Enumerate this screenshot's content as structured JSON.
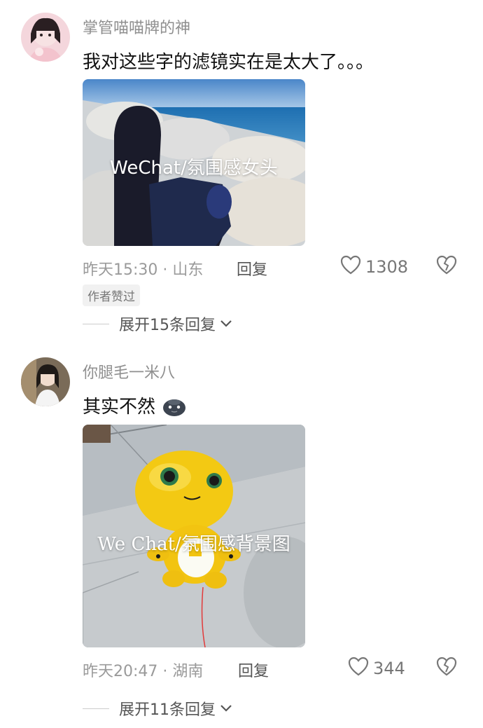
{
  "comments": [
    {
      "username": "掌管喵喵牌的神",
      "text": "我对这些字的滤镜实在是太大了。。。",
      "image_watermark": "WeChat/氛围感女头",
      "time_location": "昨天15:30 · 山东",
      "reply_label": "回复",
      "likes": "1308",
      "badge": "作者赞过",
      "expand_label": "展开15条回复"
    },
    {
      "username": "你腿毛一米八",
      "text": "其实不然",
      "image_watermark": "We Chat/氛围感背景图",
      "time_location": "昨天20:47 · 湖南",
      "reply_label": "回复",
      "likes": "344",
      "expand_label": "展开11条回复"
    }
  ],
  "colors": {
    "meta_text": "#9a9a9a",
    "username": "#8f8f8f",
    "body_text": "#111111"
  },
  "icons": [
    "heart-outline-icon",
    "broken-heart-icon",
    "chevron-down-icon",
    "emoji-icon"
  ]
}
